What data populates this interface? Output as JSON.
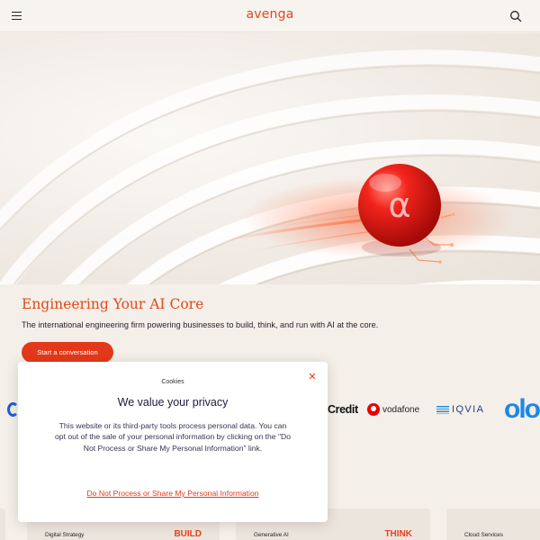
{
  "header": {
    "logo_text": "avenga",
    "menu_icon": "hamburger-menu-icon",
    "search_icon": "search-icon"
  },
  "hero": {
    "title": "Engineering Your AI Core",
    "subtitle": "The international engineering firm powering businesses to build, think, and run with AI at the core.",
    "cta_label": "Start a conversation",
    "orb_glyph": "α"
  },
  "client_logos": {
    "credit": "Credit",
    "vodafone": "vodafone",
    "iqvia": "IQVIA",
    "partial_right": "olo"
  },
  "cards": [
    {
      "label": "Digital Strategy",
      "word": "BUILD"
    },
    {
      "label": "Generative AI",
      "word": "THINK"
    },
    {
      "label": "Cloud Services",
      "word": ""
    }
  ],
  "cookie_modal": {
    "kicker": "Cookies",
    "heading": "We value your privacy",
    "body": "This website or its third-party tools process personal data. You can opt out of the sale of your personal information by clicking on the \"Do Not Process or Share My Personal Information\" link.",
    "link_label": "Do Not Process or Share My Personal Information",
    "close_icon": "close-icon"
  },
  "colors": {
    "brand_orange": "#e8431e",
    "cta_red": "#e3391a",
    "background": "#f4efe9",
    "modal_heading": "#1f1a3a"
  }
}
